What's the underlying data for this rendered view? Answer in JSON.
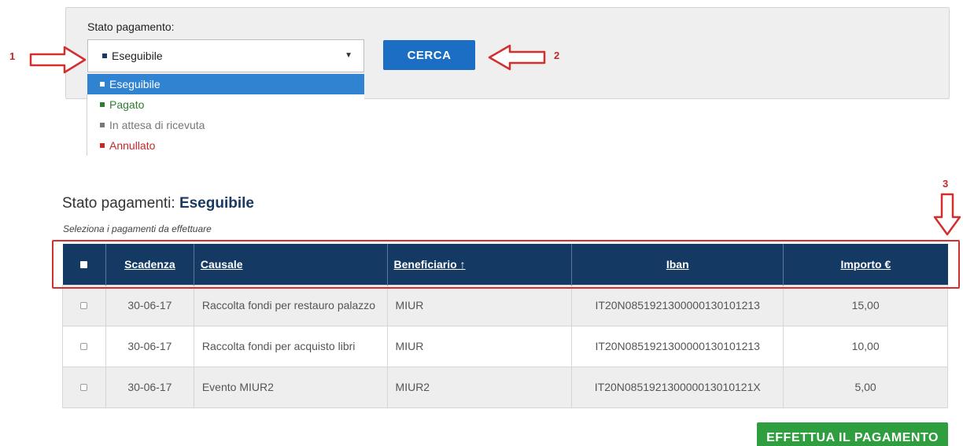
{
  "filter": {
    "label": "Stato pagamento:",
    "selected": "Eseguibile",
    "selected_color": "#1a3a63",
    "search_label": "CERCA",
    "options": [
      {
        "label": "Eseguibile",
        "color": "#ffffff",
        "active": true
      },
      {
        "label": "Pagato",
        "color": "#2e7d32",
        "active": false
      },
      {
        "label": "In attesa di ricevuta",
        "color": "#777777",
        "active": false
      },
      {
        "label": "Annullato",
        "color": "#c62828",
        "active": false
      }
    ]
  },
  "annotations": {
    "one": "1",
    "two": "2",
    "three": "3"
  },
  "results": {
    "title_prefix": "Stato pagamenti:",
    "title_value": "Eseguibile",
    "subtitle": "Seleziona i pagamenti da effettuare"
  },
  "table": {
    "headers": {
      "scadenza": "Scadenza",
      "causale": "Causale",
      "beneficiario": "Beneficiario ↑",
      "iban": "Iban",
      "importo": "Importo €"
    },
    "rows": [
      {
        "scadenza": "30-06-17",
        "causale": "Raccolta fondi per restauro palazzo",
        "beneficiario": "MIUR",
        "iban": "IT20N0851921300000130101213",
        "importo": "15,00"
      },
      {
        "scadenza": "30-06-17",
        "causale": "Raccolta fondi per acquisto libri",
        "beneficiario": "MIUR",
        "iban": "IT20N0851921300000130101213",
        "importo": "10,00"
      },
      {
        "scadenza": "30-06-17",
        "causale": "Evento MIUR2",
        "beneficiario": "MIUR2",
        "iban": "IT20N085192130000013010121X",
        "importo": "5,00"
      }
    ]
  },
  "actions": {
    "pay_label": "EFFETTUA IL PAGAMENTO"
  },
  "colors": {
    "header_bg": "#143a64",
    "search_btn": "#1c6ec5",
    "pay_btn": "#2e9e3f",
    "annotation": "#c62828"
  }
}
